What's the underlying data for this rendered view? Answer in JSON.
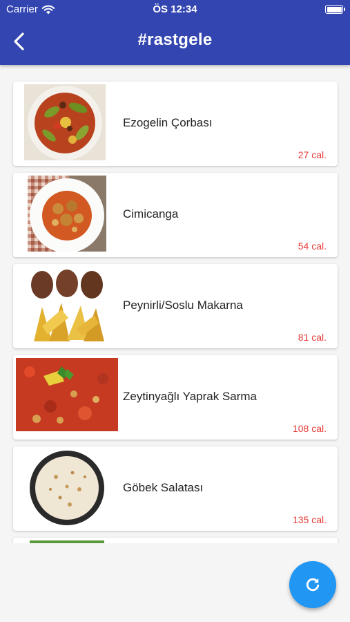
{
  "status_bar": {
    "carrier": "Carrier",
    "time": "ÖS 12:34"
  },
  "header": {
    "title": "#rastgele",
    "back_icon": "chevron-left-icon"
  },
  "foods": [
    {
      "name": "Ezogelin Çorbası",
      "calories": "27 cal.",
      "image": "vegetable-stew-plate"
    },
    {
      "name": "Cimicanga",
      "calories": "54 cal.",
      "image": "chickpea-meatball-bowl"
    },
    {
      "name": "Peynirli/Soslu Makarna",
      "calories": "81 cal.",
      "image": "kofte-with-potato-wedges"
    },
    {
      "name": "Zeytinyağlı Yaprak Sarma",
      "calories": "108 cal.",
      "image": "tomato-chickpea-stew"
    },
    {
      "name": "Göbek Salatası",
      "calories": "135 cal.",
      "image": "rice-pilaf-bowl"
    }
  ],
  "fab": {
    "icon": "refresh-icon"
  },
  "colors": {
    "app_bar": "#3345b0",
    "calories": "#e53935",
    "fab": "#2196f3",
    "background": "#f5f5f5"
  }
}
